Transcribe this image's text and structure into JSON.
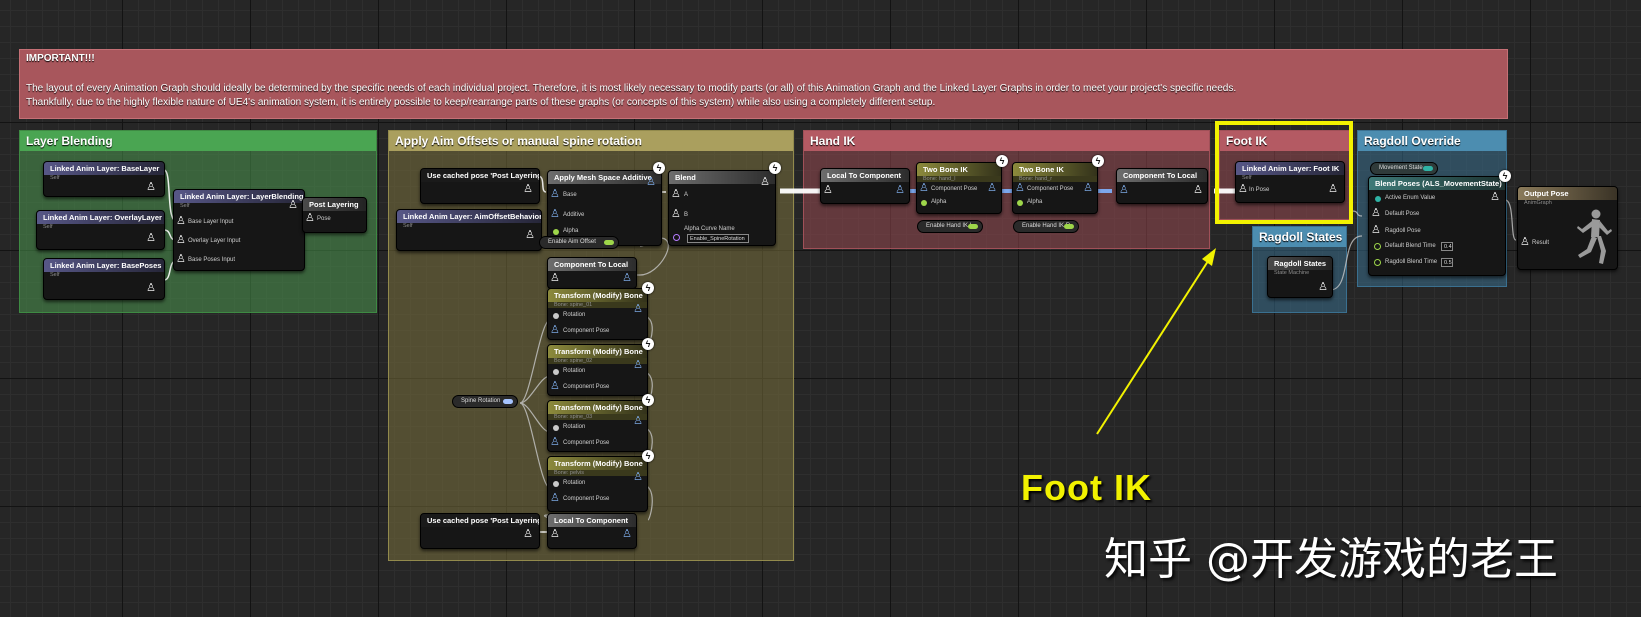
{
  "important": {
    "title": "IMPORTANT!!!",
    "line1": "The layout of every Animation Graph should ideally be determined by the specific needs of each individual project. Therefore, it is most likely necessary to modify parts (or all) of this Animation Graph and the Linked Layer Graphs in order to meet your project's specific needs.",
    "line2": "Thankfully, due to the highly flexible nature of UE4's animation system, it is entirely possible to keep/rearrange parts of these graphs (or concepts of this system) while also using a completely different setup."
  },
  "comments": {
    "layer_blending": "Layer Blending",
    "aim_offsets": "Apply Aim Offsets or manual spine rotation",
    "hand_ik": "Hand IK",
    "foot_ik": "Foot IK",
    "ragdoll_override": "Ragdoll Override",
    "ragdoll_states": "Ragdoll States"
  },
  "nodes": {
    "base_layer": {
      "title": "Linked Anim Layer: BaseLayer",
      "sub": "Self"
    },
    "overlay_layer": {
      "title": "Linked Anim Layer: OverlayLayer",
      "sub": "Self"
    },
    "base_poses": {
      "title": "Linked Anim Layer: BasePoses",
      "sub": "Self"
    },
    "layer_blending": {
      "title": "Linked Anim Layer: LayerBlending",
      "sub": "Self",
      "pins": [
        "Base Layer Input",
        "Overlay Layer Input",
        "Base Poses Input"
      ]
    },
    "post_layering": {
      "title": "Post Layering",
      "pin": "Pose"
    },
    "cached_pose_1": {
      "title": "Use cached pose 'Post Layering'"
    },
    "aim_offset_behaviors": {
      "title": "Linked Anim Layer: AimOffsetBehaviors",
      "sub": "Self"
    },
    "apply_mesh_space": {
      "title": "Apply Mesh Space Additive",
      "pins": [
        "Base",
        "Additive",
        "Alpha"
      ]
    },
    "enable_aim_offset": "Enable Aim Offset",
    "blend": {
      "title": "Blend",
      "pins": [
        "A",
        "B"
      ],
      "alpha_curve": "Alpha Curve Name",
      "curve_value": "Enable_SpineRotation"
    },
    "component_to_local": {
      "title": "Component To Local"
    },
    "transform_bones": [
      {
        "title": "Transform (Modify) Bone",
        "sub": "Bone: spine_01",
        "pin1": "Rotation",
        "pin2": "Component Pose"
      },
      {
        "title": "Transform (Modify) Bone",
        "sub": "Bone: spine_02",
        "pin1": "Rotation",
        "pin2": "Component Pose"
      },
      {
        "title": "Transform (Modify) Bone",
        "sub": "Bone: spine_03",
        "pin1": "Rotation",
        "pin2": "Component Pose"
      },
      {
        "title": "Transform (Modify) Bone",
        "sub": "Bone: pelvis",
        "pin1": "Rotation",
        "pin2": "Component Pose"
      }
    ],
    "spine_rotation": "Spine Rotation",
    "cached_pose_2": {
      "title": "Use cached pose 'Post Layering'"
    },
    "local_to_component_2": {
      "title": "Local To Component"
    },
    "local_to_component": {
      "title": "Local To Component"
    },
    "two_bone_ik_l": {
      "title": "Two Bone IK",
      "sub": "Bone: hand_l",
      "pin1": "Component Pose",
      "pin2": "Alpha"
    },
    "enable_hand_ik_l": "Enable Hand IK L",
    "two_bone_ik_r": {
      "title": "Two Bone IK",
      "sub": "Bone: hand_r",
      "pin1": "Component Pose",
      "pin2": "Alpha"
    },
    "enable_hand_ik_r": "Enable Hand IK R",
    "component_to_local_2": {
      "title": "Component To Local"
    },
    "foot_ik": {
      "title": "Linked Anim Layer: Foot IK",
      "sub": "Self",
      "pin": "In Pose"
    },
    "movement_state": "Movement State",
    "blend_poses": {
      "title": "Blend Poses (ALS_MovementState)",
      "pins": [
        "Active Enum Value",
        "Default Pose",
        "Ragdoll Pose",
        "Default Blend Time",
        "Ragdoll Blend Time"
      ],
      "default_blend_time": "0.4",
      "ragdoll_blend_time": "0.5"
    },
    "ragdoll_states": {
      "title": "Ragdoll States",
      "sub": "State Machine"
    },
    "output_pose": {
      "title": "Output Pose",
      "sub": "AnimGraph",
      "pin": "Result"
    }
  },
  "annotation": {
    "label": "Foot IK",
    "color": "#f2f200"
  },
  "watermark": "知乎 @开发游戏的老王"
}
